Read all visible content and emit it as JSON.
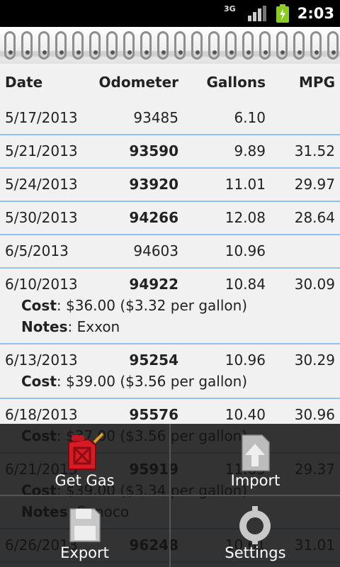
{
  "status_bar": {
    "network": "3G",
    "time": "2:03"
  },
  "table": {
    "headers": {
      "date": "Date",
      "odometer": "Odometer",
      "gallons": "Gallons",
      "mpg": "MPG"
    },
    "rows": [
      {
        "date": "5/17/2013",
        "odometer": "93485",
        "gallons": "6.10",
        "mpg": "",
        "odo_bold": false
      },
      {
        "date": "5/21/2013",
        "odometer": "93590",
        "gallons": "9.89",
        "mpg": "31.52",
        "odo_bold": true
      },
      {
        "date": "5/24/2013",
        "odometer": "93920",
        "gallons": "11.01",
        "mpg": "29.97",
        "odo_bold": true
      },
      {
        "date": "5/30/2013",
        "odometer": "94266",
        "gallons": "12.08",
        "mpg": "28.64",
        "odo_bold": true
      },
      {
        "date": "6/5/2013",
        "odometer": "94603",
        "gallons": "10.96",
        "mpg": "",
        "odo_bold": false
      },
      {
        "date": "6/10/2013",
        "odometer": "94922",
        "gallons": "10.84",
        "mpg": "30.09",
        "odo_bold": true,
        "cost_label": "Cost",
        "cost": "$36.00 ($3.32 per gallon)",
        "notes_label": "Notes",
        "notes": "Exxon"
      },
      {
        "date": "6/13/2013",
        "odometer": "95254",
        "gallons": "10.96",
        "mpg": "30.29",
        "odo_bold": true,
        "cost_label": "Cost",
        "cost": "$39.00 ($3.56 per gallon)"
      },
      {
        "date": "6/18/2013",
        "odometer": "95576",
        "gallons": "10.40",
        "mpg": "30.96",
        "odo_bold": true,
        "cost_label": "Cost",
        "cost": "$37.00 ($3.56 per gallon)"
      },
      {
        "date": "6/21/2013",
        "odometer": "95919",
        "gallons": "11.65",
        "mpg": "29.37",
        "odo_bold": true,
        "cost_label": "Cost",
        "cost": "$39.00 ($3.34 per gallon)",
        "notes_label": "Notes",
        "notes": "Sunoco"
      },
      {
        "date": "6/26/2013",
        "odometer": "96248",
        "gallons": "10.61",
        "mpg": "31.01",
        "odo_bold": true
      }
    ]
  },
  "menu": {
    "get_gas": "Get Gas",
    "import": "Import",
    "export": "Export",
    "settings": "Settings"
  },
  "icons": {
    "get_gas": "gas-can-icon",
    "import": "import-icon",
    "export": "floppy-disk-icon",
    "settings": "gear-icon"
  }
}
